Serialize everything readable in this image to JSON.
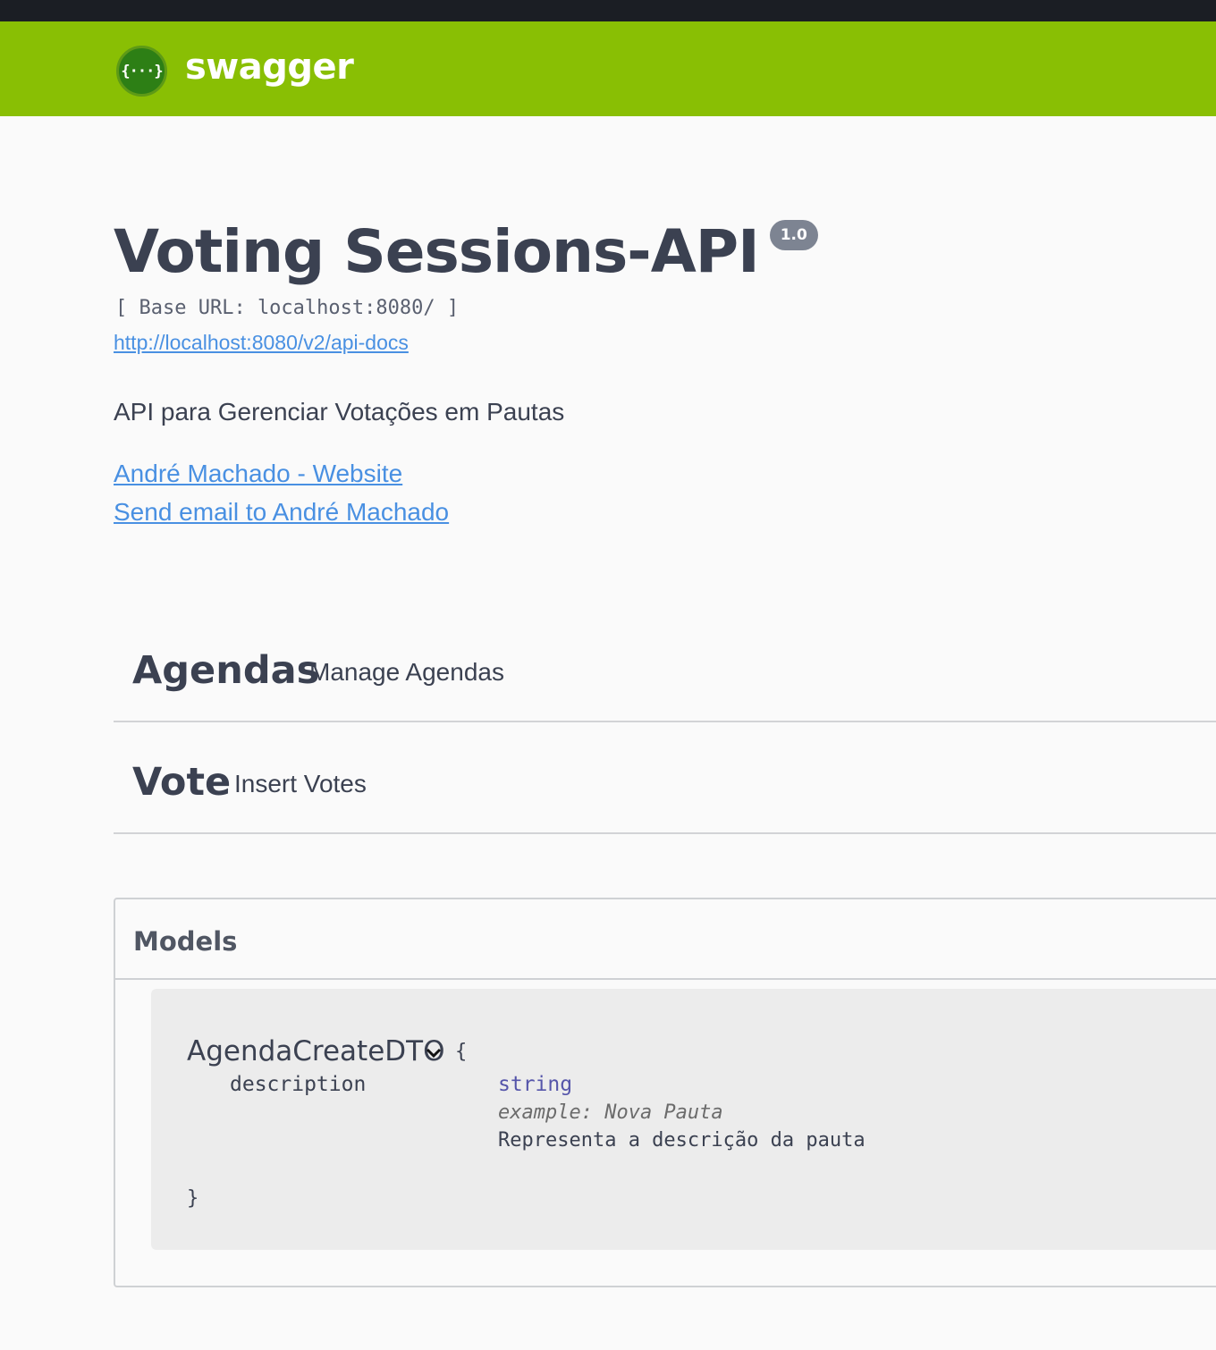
{
  "topbar": {
    "logo_glyph": "{···}",
    "logo_text": "swagger"
  },
  "info": {
    "title": "Voting Sessions-API",
    "version": "1.0",
    "base_url": "[ Base URL: localhost:8080/ ]",
    "docs_link": "http://localhost:8080/v2/api-docs",
    "description": "API para Gerenciar Votações em Pautas",
    "contact_website": "André Machado - Website",
    "contact_email": "Send email to André Machado"
  },
  "tags": [
    {
      "name": "Agendas",
      "description": "Manage Agendas"
    },
    {
      "name": "Vote",
      "description": "Insert Votes"
    }
  ],
  "models": {
    "title": "Models",
    "items": [
      {
        "name": "AgendaCreateDTO",
        "brace_open": "{",
        "brace_close": "}",
        "properties": [
          {
            "name": "description",
            "type": "string",
            "example": "example: Nova Pauta",
            "description": "Representa a descrição da pauta"
          }
        ]
      }
    ]
  },
  "colors": {
    "topbar": "#89bf04",
    "link": "#4990e2",
    "text": "#3b4151",
    "version_badge": "#7d8492"
  }
}
